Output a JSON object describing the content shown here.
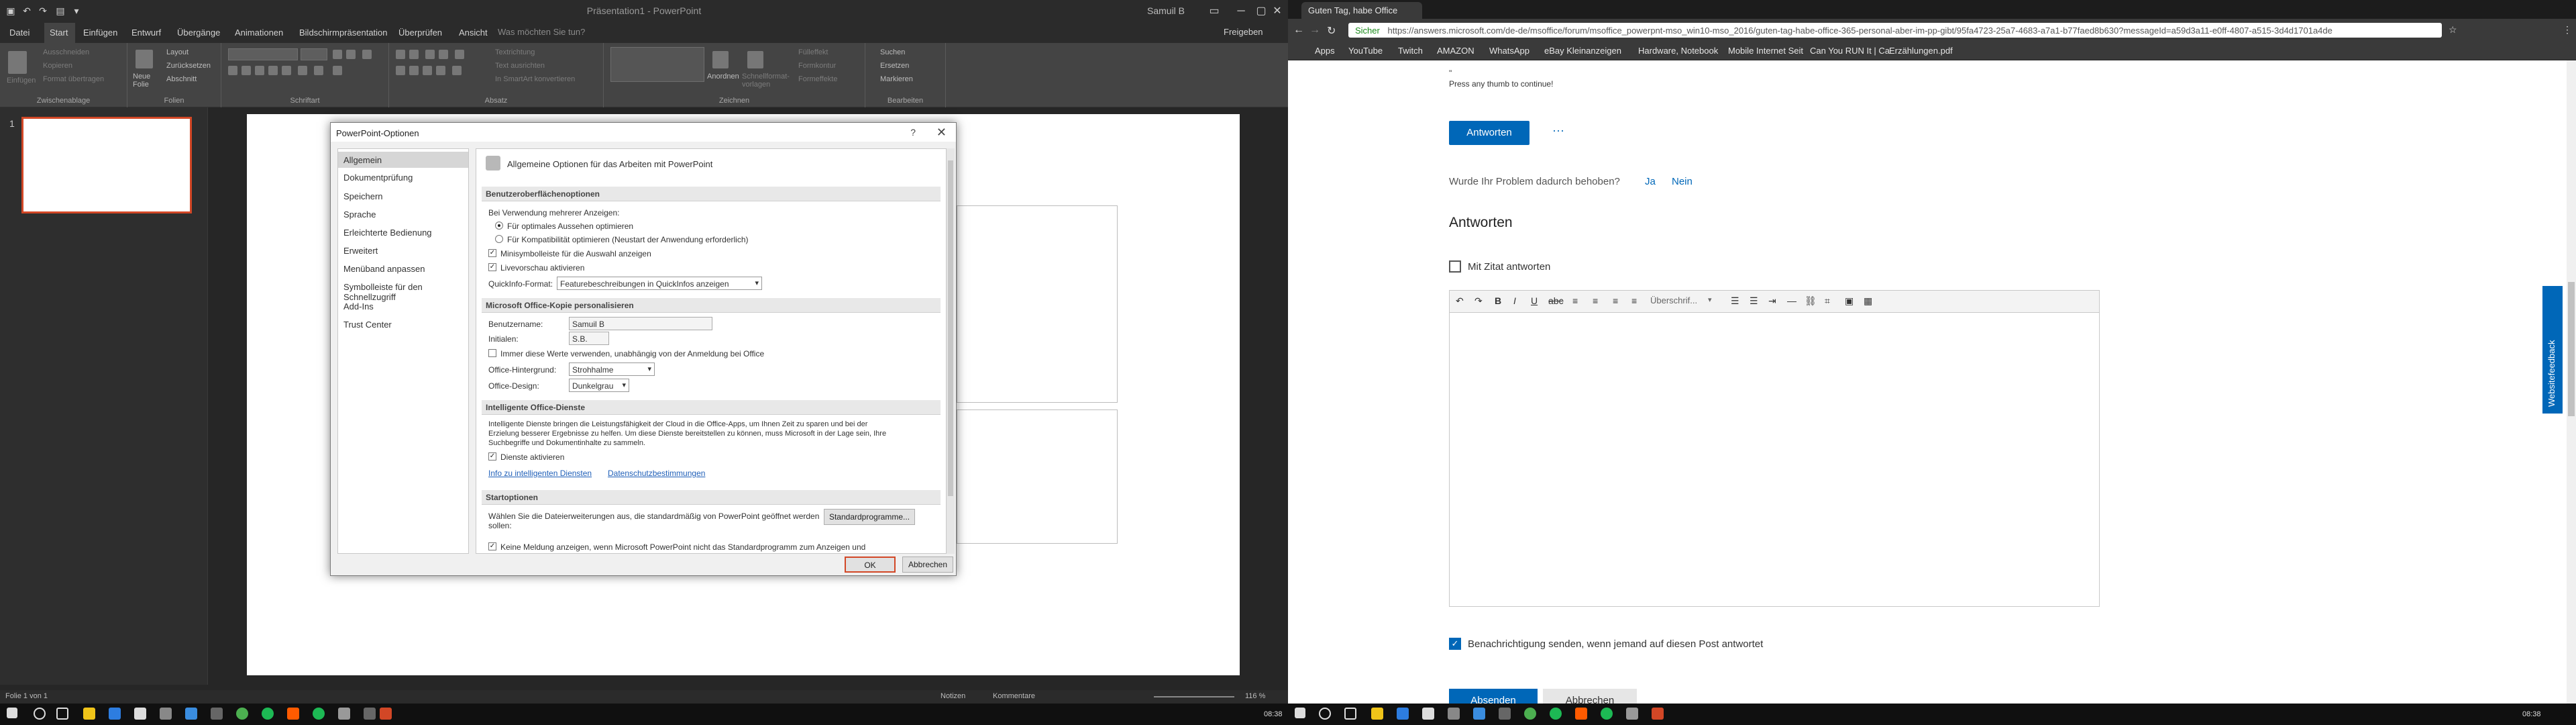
{
  "powerpoint": {
    "title": "Präsentation1 - PowerPoint",
    "user": "Samuil B",
    "tabs": [
      "Datei",
      "Start",
      "Einfügen",
      "Entwurf",
      "Übergänge",
      "Animationen",
      "Bildschirmpräsentation",
      "Überprüfen",
      "Ansicht"
    ],
    "search_placeholder": "Was möchten Sie tun?",
    "share": "Freigeben",
    "ribbon": {
      "clipboard": {
        "label": "Zwischenablage",
        "paste": "Einfügen",
        "cut": "Ausschneiden",
        "copy": "Kopieren",
        "format": "Format übertragen"
      },
      "slides": {
        "label": "Folien",
        "new": "Neue Folie",
        "layout": "Layout",
        "reset": "Zurücksetzen",
        "section": "Abschnitt"
      },
      "font": {
        "label": "Schriftart"
      },
      "paragraph": {
        "label": "Absatz",
        "textdir": "Textrichtung",
        "align": "Text ausrichten",
        "smartart": "In SmartArt konvertieren"
      },
      "drawing": {
        "label": "Zeichnen",
        "arrange": "Anordnen",
        "quickstyles": "Schnellformat-vorlagen",
        "fill": "Fülleffekt",
        "outline": "Formkontur",
        "effects": "Formeffekte"
      },
      "editing": {
        "label": "Bearbeiten",
        "find": "Suchen",
        "replace": "Ersetzen",
        "select": "Markieren"
      }
    },
    "thumb_number": "1",
    "status": {
      "slide": "Folie 1 von 1",
      "notes": "Notizen",
      "comments": "Kommentare",
      "zoom": "116 %"
    },
    "clock": "08:38"
  },
  "dialog": {
    "title": "PowerPoint-Optionen",
    "help": "?",
    "nav": [
      "Allgemein",
      "Dokumentprüfung",
      "Speichern",
      "Sprache",
      "Erleichterte Bedienung",
      "Erweitert",
      "Menüband anpassen",
      "Symbolleiste für den Schnellzugriff",
      "Add-Ins",
      "Trust Center"
    ],
    "heading": "Allgemeine Optionen für das Arbeiten mit PowerPoint",
    "sec_ui": "Benutzeroberflächenoptionen",
    "multi_display": "Bei Verwendung mehrerer Anzeigen:",
    "opt_optimal": "Für optimales Aussehen optimieren",
    "opt_compat": "Für Kompatibilität optimieren (Neustart der Anwendung erforderlich)",
    "minitoolbar": "Minisymbolleiste für die Auswahl anzeigen",
    "livepreview": "Livevorschau aktivieren",
    "quickinfo_label": "QuickInfo-Format:",
    "quickinfo_value": "Featurebeschreibungen in QuickInfos anzeigen",
    "sec_personal": "Microsoft Office-Kopie personalisieren",
    "username_label": "Benutzername:",
    "username_value": "Samuil B",
    "initials_label": "Initialen:",
    "initials_value": "S.B.",
    "always_use": "Immer diese Werte verwenden, unabhängig von der Anmeldung bei Office",
    "bg_label": "Office-Hintergrund:",
    "bg_value": "Strohhalme",
    "design_label": "Office-Design:",
    "design_value": "Dunkelgrau",
    "sec_smart": "Intelligente Office-Dienste",
    "smart_text1": "Intelligente Dienste bringen die Leistungsfähigkeit der Cloud in die Office-Apps, um Ihnen Zeit zu sparen und bei der",
    "smart_text2": "Erzielung besserer Ergebnisse zu helfen. Um diese Dienste bereitstellen zu können, muss Microsoft in der Lage sein, Ihre",
    "smart_text3": "Suchbegriffe und Dokumentinhalte zu sammeln.",
    "enable_services": "Dienste aktivieren",
    "link_info": "Info zu intelligenten Diensten",
    "link_privacy": "Datenschutzbestimmungen",
    "sec_start": "Startoptionen",
    "start_text1": "Wählen Sie die Dateierweiterungen aus, die standardmäßig von PowerPoint geöffnet werden",
    "start_text2": "sollen:",
    "default_programs": "Standardprogramme...",
    "start_text3": "Keine Meldung anzeigen, wenn Microsoft PowerPoint nicht das Standardprogramm zum Anzeigen und",
    "ok": "OK",
    "cancel": "Abbrechen"
  },
  "chrome": {
    "tab_title": "Guten Tag, habe Office",
    "secure": "Sicher",
    "url": "https://answers.microsoft.com/de-de/msoffice/forum/msoffice_powerpnt-mso_win10-mso_2016/guten-tag-habe-office-365-personal-aber-im-pp-gibt/95fa4723-25a7-4683-a7a1-b77faed8b630?messageId=a59d3a11-e0ff-4807-a515-3d4d1701a4de",
    "bookmarks": [
      "Apps",
      "YouTube",
      "Twitch",
      "AMAZON",
      "WhatsApp",
      "eBay Kleinanzeigen",
      "Hardware, Notebook",
      "Mobile Internet Seit",
      "Can You RUN It | Ca",
      "Erzählungen.pdf"
    ],
    "page": {
      "quote_line": "\"",
      "thumb_text": "Press any thumb to continue!",
      "reply": "Antworten",
      "more": "···",
      "solved_question": "Wurde Ihr Problem dadurch behoben?",
      "yes": "Ja",
      "no": "Nein",
      "answers_heading": "Antworten",
      "quote_reply": "Mit Zitat antworten",
      "format_dropdown": "Überschrif...",
      "notify": "Benachrichtigung senden, wenn jemand auf diesen Post antwortet",
      "submit": "Absenden",
      "cancel": "Abbrechen",
      "feedback": "Websitefeedback"
    },
    "clock": "08:38"
  },
  "colors": {
    "accent": "#d24726",
    "link": "#0067b8"
  }
}
